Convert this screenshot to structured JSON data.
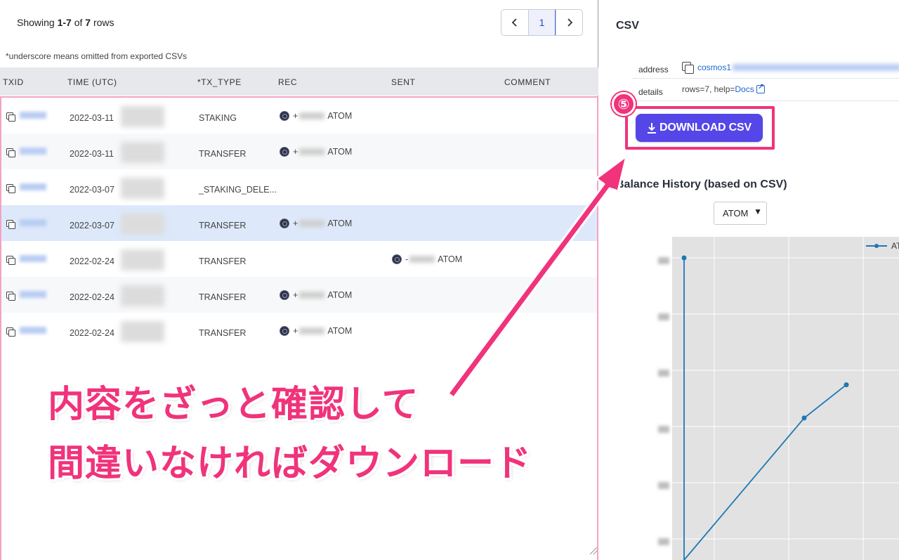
{
  "table": {
    "showing_prefix": "Showing ",
    "showing_range": "1-7",
    "showing_of": " of ",
    "showing_total": "7",
    "showing_suffix": " rows",
    "note": "*underscore means omitted from exported CSVs",
    "pagination": {
      "prev_icon": "chevron-left-icon",
      "current_page": "1",
      "next_icon": "chevron-right-icon"
    },
    "columns": [
      "TXID",
      "TIME (UTC)",
      "*TX_TYPE",
      "REC",
      "SENT",
      "COMMENT"
    ],
    "rows": [
      {
        "date": "2022-03-11",
        "tx_type": "STAKING",
        "rec_sign": "+",
        "rec_unit": "ATOM",
        "sent_sign": "",
        "sent_unit": ""
      },
      {
        "date": "2022-03-11",
        "tx_type": "TRANSFER",
        "rec_sign": "+",
        "rec_unit": "ATOM",
        "sent_sign": "",
        "sent_unit": ""
      },
      {
        "date": "2022-03-07",
        "tx_type": "_STAKING_DELE...",
        "rec_sign": "",
        "rec_unit": "",
        "sent_sign": "",
        "sent_unit": ""
      },
      {
        "date": "2022-03-07",
        "tx_type": "TRANSFER",
        "rec_sign": "+",
        "rec_unit": "ATOM",
        "sent_sign": "",
        "sent_unit": ""
      },
      {
        "date": "2022-02-24",
        "tx_type": "TRANSFER",
        "rec_sign": "",
        "rec_unit": "",
        "sent_sign": "-",
        "sent_unit": "ATOM"
      },
      {
        "date": "2022-02-24",
        "tx_type": "TRANSFER",
        "rec_sign": "+",
        "rec_unit": "ATOM",
        "sent_sign": "",
        "sent_unit": ""
      },
      {
        "date": "2022-02-24",
        "tx_type": "TRANSFER",
        "rec_sign": "+",
        "rec_unit": "ATOM",
        "sent_sign": "",
        "sent_unit": ""
      }
    ]
  },
  "annotation": {
    "line1": "内容をざっと確認して",
    "line2": "間違いなければダウンロード",
    "step_number": "⑤",
    "color": "#f0337b"
  },
  "csv_panel": {
    "title": "CSV",
    "address_label": "address",
    "address_value": "cosmos1",
    "details_label": "details",
    "details_prefix": "rows=7, help=",
    "details_link": "Docs",
    "download_label": "DOWNLOAD CSV",
    "download_color": "#5546e8",
    "balance_title": "Balance History (based on CSV)",
    "asset_selected": "ATOM",
    "asset_caret": "▼"
  },
  "chart_data": {
    "type": "line",
    "title": "",
    "xlabel": "",
    "ylabel": "",
    "grid": true,
    "legend_placement": "top-right",
    "series": [
      {
        "name": "AT",
        "color": "#1f77b4",
        "values": [
          1.0,
          0.0,
          0.47,
          0.58
        ]
      }
    ]
  }
}
